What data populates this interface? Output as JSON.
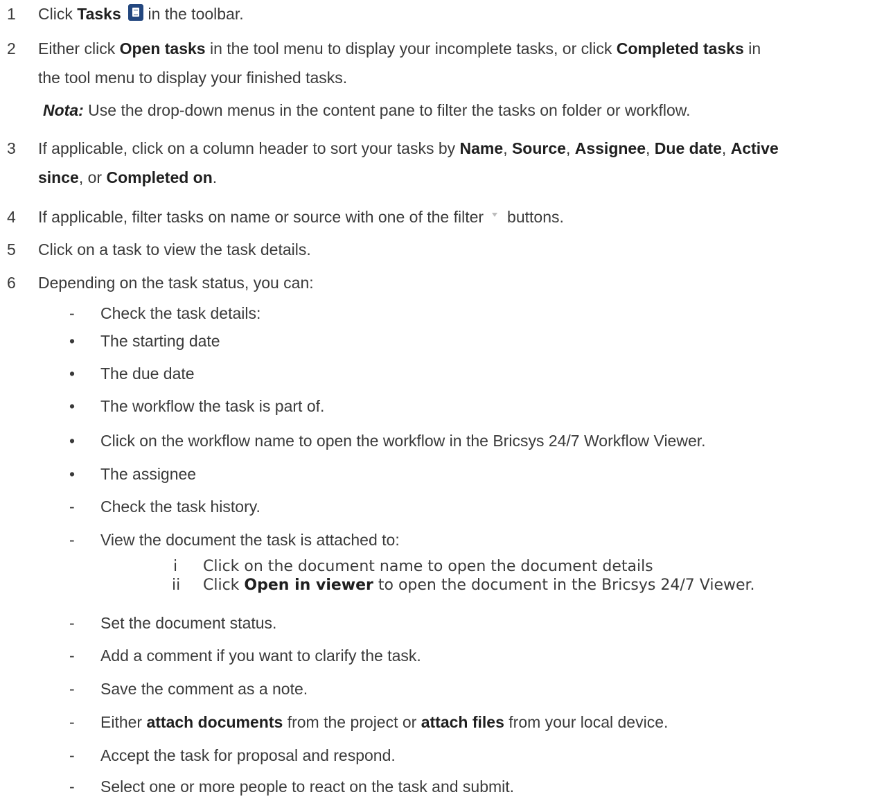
{
  "steps": {
    "s1": {
      "num": "1",
      "pre": "Click",
      "tasks": "Tasks",
      "post": "in the toolbar."
    },
    "s2": {
      "num": "2",
      "pre": "Either click",
      "open_tasks": "Open tasks",
      "mid": "in the tool menu to display your incomplete tasks, or click",
      "completed_tasks": "Completed tasks",
      "post": "in",
      "line2": "the tool menu to display your finished tasks."
    },
    "nota": {
      "label": "Nota:",
      "text": "Use the drop-down menus in the content pane to filter the tasks on folder or workflow."
    },
    "s3": {
      "num": "3",
      "pre": "If applicable, click on a column header to sort your tasks by",
      "name": "Name",
      "source": "Source",
      "assignee": "Assignee",
      "due_date": "Due date",
      "active": "Active",
      "since": "since",
      "or": "or",
      "completed_on": "Completed on"
    },
    "s4": {
      "num": "4",
      "pre": "If applicable, filter tasks on name or source with one of the filter",
      "post": "buttons."
    },
    "s5": {
      "num": "5",
      "text": "Click on a task to view the task details."
    },
    "s6": {
      "num": "6",
      "text": "Depending on the task status, you can:"
    }
  },
  "items": {
    "check_details": "Check the task details:",
    "starting_date": "The starting date",
    "due_date": "The due date",
    "workflow": "The workflow the task is part of.",
    "click_workflow": "Click on the workflow name to open the workflow in the Bricsys 24/7 Workflow Viewer.",
    "assignee": "The assignee",
    "history": "Check the task history.",
    "view_doc": "View the document the task is attached to:",
    "sub_i": {
      "num": "i",
      "text": "Click on the document name to open the document details"
    },
    "sub_ii": {
      "num": "ii",
      "pre": "Click",
      "open_viewer": "Open in viewer",
      "post": "to open the document in the Bricsys 24/7 Viewer."
    },
    "set_status": "Set the document status.",
    "add_comment": "Add a comment if you want to clarify the task.",
    "save_note": "Save the comment as a note.",
    "attach": {
      "pre": "Either",
      "attach_documents": "attach documents",
      "mid": "from the project or",
      "attach_files": "attach files",
      "post": "from your local device."
    },
    "accept": "Accept the task for proposal and respond.",
    "select_people": "Select one or more people to react on the task and submit."
  },
  "markers": {
    "dash": "-",
    "dot": "•"
  },
  "icons": {
    "tasks_icon": "clipboard-icon",
    "tasks_icon_color": "#23477f",
    "filter_icon": "filter-icon"
  }
}
